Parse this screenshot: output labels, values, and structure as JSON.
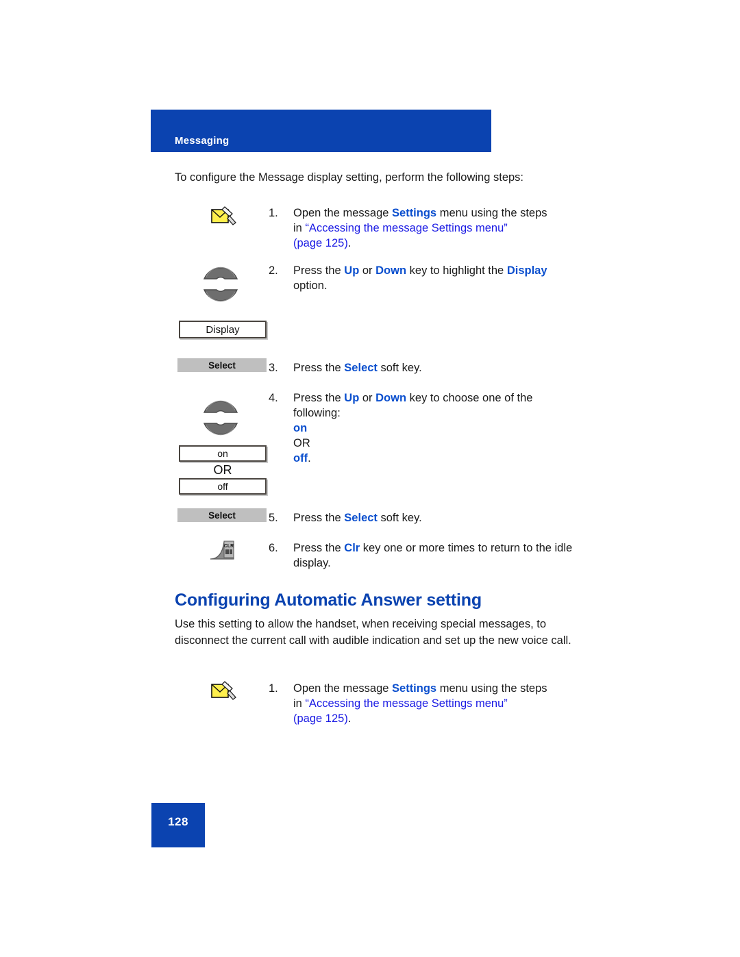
{
  "header": {
    "title": "Messaging",
    "band_color": "#0B43B0"
  },
  "intro": {
    "text": "To configure the Message display setting, perform the following steps:"
  },
  "display_steps": [
    {
      "number": "1.",
      "icon": "envelope-settings-icon",
      "text_parts": {
        "a": "Open the message ",
        "kw1": "Settings",
        "b": " menu using the steps",
        "line2_pre": "in ",
        "link": "“Accessing the message Settings menu”",
        "line3": "(page 125)",
        "end": "."
      }
    },
    {
      "number": "2.",
      "icon": "up-down-nav-keys",
      "text_parts": {
        "a": "Press the ",
        "kw1": "Up",
        "b": " or ",
        "kw2": "Down",
        "c": " key to highlight the ",
        "kw3": "Display",
        "d": " option."
      }
    },
    {
      "number": "3.",
      "icon": "select-soft-key",
      "text_parts": {
        "a": "Press the ",
        "kw1": "Select",
        "b": " soft key."
      }
    },
    {
      "number": "4.",
      "icon": "up-down-nav-keys",
      "text_parts": {
        "a": "Press the ",
        "kw1": "Up",
        "b": " or ",
        "kw2": "Down",
        "c": " key to choose one of the following:",
        "opt1": "on",
        "or": "OR",
        "opt2": "off",
        "period": "."
      }
    },
    {
      "number": "5.",
      "icon": "select-soft-key",
      "text_parts": {
        "a": "Press the ",
        "kw1": "Select",
        "b": " soft key."
      }
    },
    {
      "number": "6.",
      "icon": "clr-key",
      "text_parts": {
        "a": "Press the ",
        "kw1": "Clr",
        "b": " key one or more times to return to the idle display."
      }
    }
  ],
  "widgets": {
    "display_option_label": "Display",
    "on_option_label": "on",
    "or_separator_label": "OR",
    "off_option_label": "off",
    "select_softkey_label": "Select",
    "clr_key_label": "CLR"
  },
  "section": {
    "heading": "Configuring Automatic Answer setting",
    "heading_color": "#0B43B0",
    "paragraph": "Use this setting to allow the handset, when receiving special messages, to disconnect the current call with audible indication and set up the new voice call."
  },
  "auto_answer_steps": [
    {
      "number": "1.",
      "icon": "envelope-settings-icon",
      "text_parts": {
        "a": "Open the message ",
        "kw1": "Settings",
        "b": " menu using the steps",
        "line2_pre": "in ",
        "link": "“Accessing the message Settings menu”",
        "line3": "(page 125)",
        "end": "."
      }
    }
  ],
  "footer": {
    "page_number": "128"
  },
  "colors": {
    "brand_blue": "#0B43B0",
    "keyword_blue": "#0B4FCE",
    "link_blue": "#1B1BE4",
    "softkey_gray": "#bfbfbf",
    "box_border": "#4a4540"
  }
}
